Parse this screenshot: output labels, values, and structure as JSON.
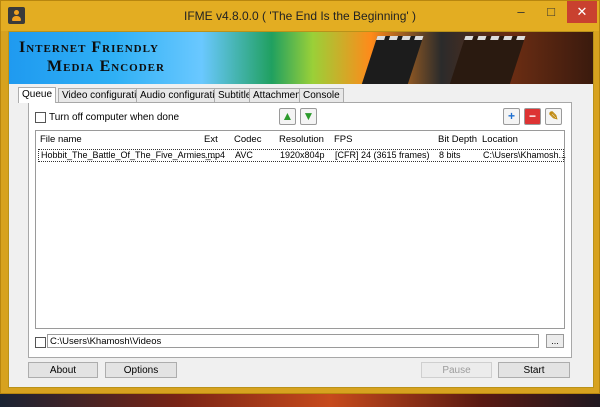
{
  "window": {
    "title": "IFME v4.8.0.0 ( 'The End Is the Beginning' )",
    "controls": {
      "minimize": "–",
      "maximize": "□",
      "close": "✕"
    }
  },
  "banner": {
    "line1": "Internet Friendly",
    "line2": "Media Encoder"
  },
  "tabs": [
    {
      "label": "Queue",
      "active": true
    },
    {
      "label": "Video configuration"
    },
    {
      "label": "Audio configuration"
    },
    {
      "label": "Subtitle"
    },
    {
      "label": "Attachment"
    },
    {
      "label": "Console"
    }
  ],
  "queue": {
    "turn_off_label": "Turn off computer when done",
    "turn_off_checked": false,
    "columns": [
      "File name",
      "Ext",
      "Codec",
      "Resolution",
      "FPS",
      "Bit Depth",
      "Location"
    ],
    "rows": [
      [
        "Hobbit_The_Battle_Of_The_Five_Armies_...",
        ".mp4",
        "AVC",
        "1920x804p",
        "[CFR] 24 (3615 frames)",
        "8 bits",
        "C:\\Users\\Khamosh..."
      ]
    ],
    "toolbar_icons": [
      "move-up-icon",
      "move-down-icon",
      "add-icon",
      "remove-icon",
      "clear-icon"
    ]
  },
  "output": {
    "checked": false,
    "path": "C:\\Users\\Khamosh\\Videos",
    "browse_label": "..."
  },
  "buttons": {
    "about": "About",
    "options": "Options",
    "pause": "Pause",
    "start": "Start"
  },
  "colors": {
    "window_frame": "#e3ad22",
    "close_button": "#c9412f",
    "accent_green": "#2c9a2c",
    "accent_blue": "#1f6fd0"
  }
}
